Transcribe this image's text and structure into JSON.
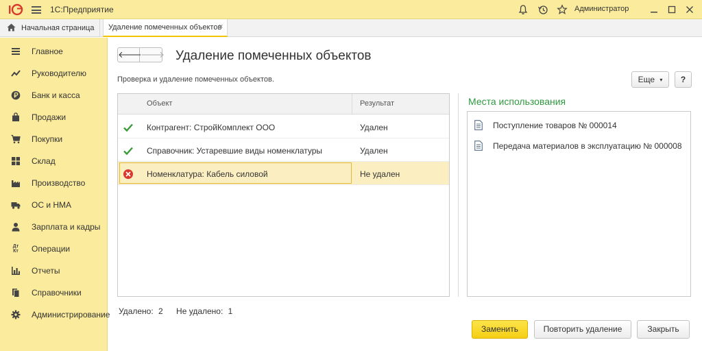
{
  "titlebar": {
    "app_title": "1С:Предприятие",
    "user": "Администратор",
    "icons": [
      "logo-1c-icon",
      "menu-icon",
      "bell-icon",
      "history-icon",
      "star-icon",
      "minimize-icon",
      "maximize-icon",
      "close-icon"
    ]
  },
  "tabs": {
    "home_label": "Начальная страница",
    "active_label": "Удаление помеченных объектов",
    "close_glyph": "×"
  },
  "sidebar": {
    "items": [
      {
        "label": "Главное",
        "icon": "menu-lines-icon"
      },
      {
        "label": "Руководителю",
        "icon": "chart-line-icon"
      },
      {
        "label": "Банк и касса",
        "icon": "ruble-coin-icon"
      },
      {
        "label": "Продажи",
        "icon": "bag-icon"
      },
      {
        "label": "Покупки",
        "icon": "cart-icon"
      },
      {
        "label": "Склад",
        "icon": "warehouse-grid-icon"
      },
      {
        "label": "Производство",
        "icon": "factory-icon"
      },
      {
        "label": "ОС и НМА",
        "icon": "truck-icon"
      },
      {
        "label": "Зарплата и кадры",
        "icon": "person-icon"
      },
      {
        "label": "Операции",
        "icon": "debit-credit-icon"
      },
      {
        "label": "Отчеты",
        "icon": "bar-chart-icon"
      },
      {
        "label": "Справочники",
        "icon": "books-icon"
      },
      {
        "label": "Администрирование",
        "icon": "gear-icon"
      }
    ],
    "dt_kt": "Дт Кт"
  },
  "main": {
    "title": "Удаление помеченных объектов",
    "subtitle": "Проверка  и удаление помеченных объектов.",
    "more_label": "Еще",
    "help_label": "?",
    "back_glyph": "🡐",
    "fwd_glyph": "🡒"
  },
  "table": {
    "columns": [
      "Объект",
      "Результат"
    ],
    "rows": [
      {
        "object": "Контрагент: СтройКомплект ООО",
        "result": "Удален",
        "status": "ok"
      },
      {
        "object": "Справочник: Устаревшие виды номенклатуры",
        "result": "Удален",
        "status": "ok"
      },
      {
        "object": "Номенклатура: Кабель силовой",
        "result": "Не удален",
        "status": "error"
      }
    ]
  },
  "usage": {
    "title": "Места использования",
    "items": [
      "Поступление товаров № 000014",
      "Передача материалов в эксплуатацию № 000008"
    ]
  },
  "footer": {
    "deleted_label": "Удалено:",
    "deleted_count": "2",
    "not_deleted_label": "Не удалено:",
    "not_deleted_count": "1",
    "replace_label": "Заменить",
    "retry_label": "Повторить удаление",
    "close_label": "Закрыть"
  },
  "colors": {
    "accent_yellow": "#fbeb9c",
    "selected_row": "#fbeec0",
    "usage_green": "#2e9a3e",
    "ok_green": "#3a9b3a",
    "error_red": "#d9382c"
  }
}
